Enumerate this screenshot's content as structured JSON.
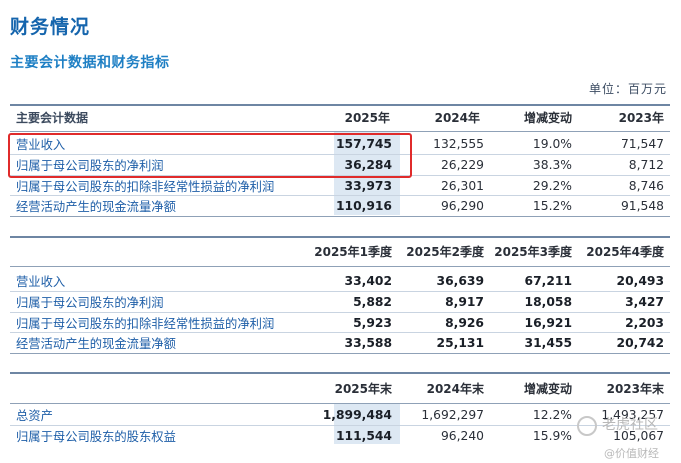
{
  "page": {
    "title": "财务情况",
    "subtitle": "主要会计数据和财务指标",
    "unit": "单位：百万元"
  },
  "table1": {
    "headers": [
      "主要会计数据",
      "2025年",
      "2024年",
      "增减变动",
      "2023年"
    ],
    "rows": [
      {
        "label": "营业收入",
        "v2025": "157,745",
        "v2024": "132,555",
        "change": "19.0%",
        "v2023": "71,547"
      },
      {
        "label": "归属于母公司股东的净利润",
        "v2025": "36,284",
        "v2024": "26,229",
        "change": "38.3%",
        "v2023": "8,712"
      },
      {
        "label": "归属于母公司股东的扣除非经常性损益的净利润",
        "v2025": "33,973",
        "v2024": "26,301",
        "change": "29.2%",
        "v2023": "8,746"
      },
      {
        "label": "经营活动产生的现金流量净额",
        "v2025": "110,916",
        "v2024": "96,290",
        "change": "15.2%",
        "v2023": "91,548"
      }
    ]
  },
  "table2": {
    "headers": [
      "2025年1季度",
      "2025年2季度",
      "2025年3季度",
      "2025年4季度"
    ],
    "rows": [
      {
        "label": "营业收入",
        "q1": "33,402",
        "q2": "36,639",
        "q3": "67,211",
        "q4": "20,493"
      },
      {
        "label": "归属于母公司股东的净利润",
        "q1": "5,882",
        "q2": "8,917",
        "q3": "18,058",
        "q4": "3,427"
      },
      {
        "label": "归属于母公司股东的扣除非经常性损益的净利润",
        "q1": "5,923",
        "q2": "8,926",
        "q3": "16,921",
        "q4": "2,203"
      },
      {
        "label": "经营活动产生的现金流量净额",
        "q1": "33,588",
        "q2": "25,131",
        "q3": "31,455",
        "q4": "20,742"
      }
    ]
  },
  "table3": {
    "headers": [
      "2025年末",
      "2024年末",
      "增减变动",
      "2023年末"
    ],
    "rows": [
      {
        "label": "总资产",
        "v2025": "1,899,484",
        "v2024": "1,692,297",
        "change": "12.2%",
        "v2023": "1,493,257"
      },
      {
        "label": "归属于母公司股东的股东权益",
        "v2025": "111,544",
        "v2024": "96,240",
        "change": "15.9%",
        "v2023": "105,067"
      }
    ]
  },
  "watermark": {
    "line1": "老虎社区",
    "line2": "@价值财经"
  },
  "colors": {
    "title": "#1565ad",
    "highlight": "#e02b2b",
    "shade": "#dde8f3"
  }
}
